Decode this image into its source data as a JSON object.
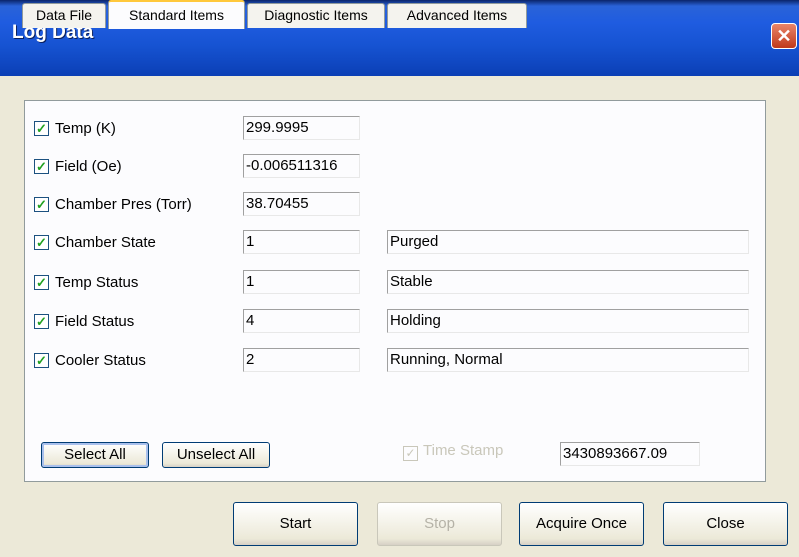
{
  "window": {
    "title": "Log Data",
    "close_glyph": "✕"
  },
  "tabs": [
    {
      "label": "Data File",
      "active": false
    },
    {
      "label": "Standard Items",
      "active": true
    },
    {
      "label": "Diagnostic Items",
      "active": false
    },
    {
      "label": "Advanced Items",
      "active": false
    }
  ],
  "items": [
    {
      "label": "Temp (K)",
      "checked": true,
      "value": "299.9995"
    },
    {
      "label": "Field (Oe)",
      "checked": true,
      "value": "-0.006511316"
    },
    {
      "label": "Chamber Pres (Torr)",
      "checked": true,
      "value": "38.70455"
    },
    {
      "label": "Chamber State",
      "checked": true,
      "value": "1",
      "status": "Purged"
    },
    {
      "label": "Temp Status",
      "checked": true,
      "value": "1",
      "status": "Stable"
    },
    {
      "label": "Field Status",
      "checked": true,
      "value": "4",
      "status": "Holding"
    },
    {
      "label": "Cooler Status",
      "checked": true,
      "value": "2",
      "status": "Running, Normal"
    }
  ],
  "panel_buttons": {
    "select_all": "Select All",
    "unselect_all": "Unselect All"
  },
  "time_stamp": {
    "label": "Time Stamp",
    "checked": true,
    "enabled": false,
    "value": "3430893667.09"
  },
  "footer_buttons": {
    "start": "Start",
    "stop": "Stop",
    "acquire_once": "Acquire Once",
    "close": "Close"
  },
  "check_glyph": "✓"
}
